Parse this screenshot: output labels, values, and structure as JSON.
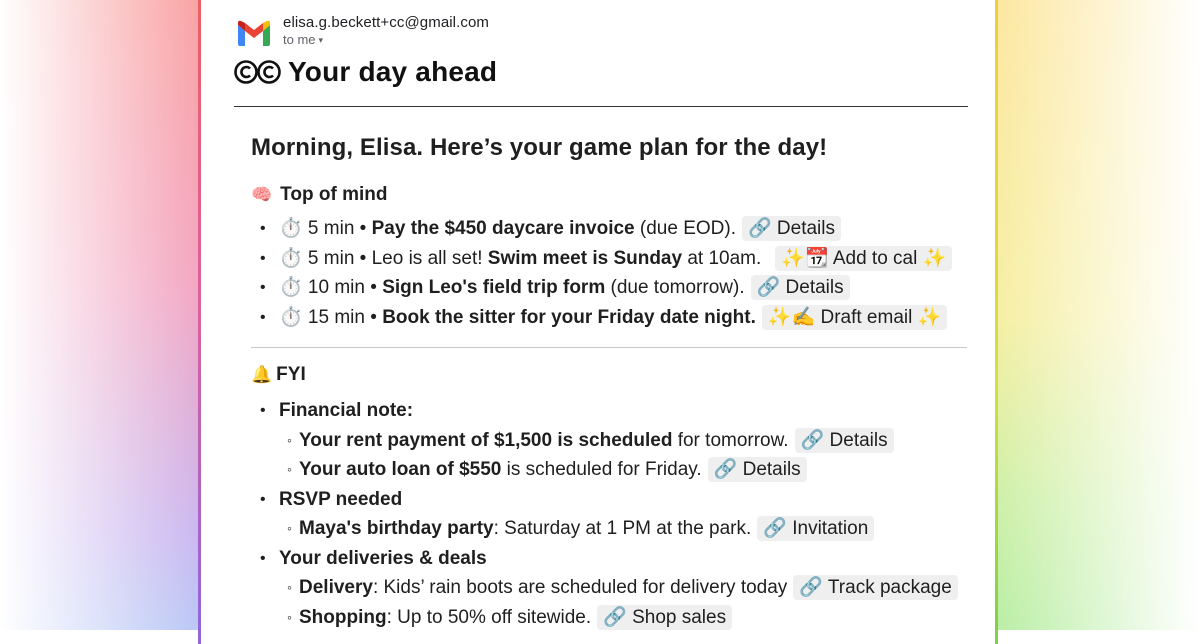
{
  "sender": {
    "email": "elisa.g.beckett+cc@gmail.com",
    "to": "to me",
    "caret": "▾"
  },
  "email_title": "Your day ahead",
  "greeting": "Morning, Elisa. Here’s your game plan for the day!",
  "top_of_mind": {
    "emoji": "🧠",
    "heading": "Top of mind",
    "items": [
      {
        "prefix": "⏱️ 5 min • ",
        "bold": "Pay the $450 daycare invoice",
        "rest": " (due EOD).",
        "chip": "🔗 Details"
      },
      {
        "prefix": "⏱️ 5 min • Leo is all set! ",
        "bold": "Swim meet is Sunday",
        "rest": " at 10am.",
        "chip": "✨📆 Add to cal ✨"
      },
      {
        "prefix": "⏱️ 10 min • ",
        "bold": "Sign Leo's field trip form",
        "rest": " (due tomorrow).",
        "chip": "🔗 Details"
      },
      {
        "prefix": "⏱️ 15 min • ",
        "bold": "Book the sitter for your Friday date night.",
        "rest": "",
        "chip": "✨✍️ Draft email ✨"
      }
    ]
  },
  "fyi": {
    "emoji": "🔔",
    "heading": "FYI",
    "groups": [
      {
        "title": "Financial note:",
        "items": [
          {
            "bold": "Your rent payment of $1,500 is scheduled",
            "rest": " for tomorrow.",
            "chip": "🔗 Details"
          },
          {
            "bold": "Your auto loan of $550",
            "rest": " is scheduled for Friday.",
            "chip": "🔗 Details"
          }
        ]
      },
      {
        "title": "RSVP needed",
        "items": [
          {
            "bold": "Maya's birthday party",
            "rest": ": Saturday at 1 PM at the park.",
            "chip": "🔗 Invitation"
          }
        ]
      },
      {
        "title": "Your deliveries & deals",
        "items": [
          {
            "bold": "Delivery",
            "rest": ": Kids’ rain boots are scheduled for delivery today",
            "chip": "🔗 Track package"
          },
          {
            "bold": "Shopping",
            "rest": ": Up to 50% off sitewide.",
            "chip": "🔗 Shop sales"
          }
        ]
      }
    ]
  },
  "colors": {
    "gmail_blue": "#4285F4",
    "gmail_red": "#EA4335",
    "gmail_yellow": "#FBBC05",
    "gmail_green": "#34A853"
  }
}
